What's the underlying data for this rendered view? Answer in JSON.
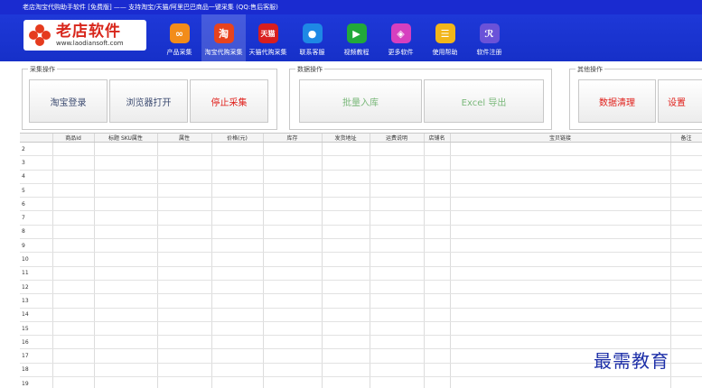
{
  "window": {
    "title": "老店淘宝代购助手软件 [免费版] —— 支持淘宝/天猫/阿里巴巴商品一键采集 (QQ:售后客服)"
  },
  "logo": {
    "name": "老店软件",
    "url": "www.laodiansoft.com"
  },
  "nav": {
    "items": [
      {
        "label": "产品采集",
        "icon": "link-icon",
        "color": "#f28c1a",
        "glyph": "∞",
        "active": false
      },
      {
        "label": "淘宝代购采集",
        "icon": "taobao-icon",
        "color": "#e8431d",
        "glyph": "淘",
        "active": true
      },
      {
        "label": "天猫代购采集",
        "icon": "tmall-icon",
        "color": "#d81e1e",
        "glyph": "天猫",
        "active": false
      },
      {
        "label": "联系客服",
        "icon": "qq-icon",
        "color": "#1e88e5",
        "glyph": "●",
        "active": false
      },
      {
        "label": "视频教程",
        "icon": "play-icon",
        "color": "#22a83a",
        "glyph": "▶",
        "active": false
      },
      {
        "label": "更多软件",
        "icon": "box-icon",
        "color": "#d63fbf",
        "glyph": "◈",
        "active": false
      },
      {
        "label": "使用帮助",
        "icon": "document-icon",
        "color": "#f2b51a",
        "glyph": "☰",
        "active": false
      },
      {
        "label": "软件注册",
        "icon": "users-icon",
        "color": "#6a52d8",
        "glyph": "ℛ",
        "active": false
      }
    ]
  },
  "groups": {
    "collect": {
      "title": "采集操作",
      "buttons": [
        "淘宝登录",
        "浏览器打开",
        "停止采集"
      ]
    },
    "data": {
      "title": "数据操作",
      "buttons": [
        "批量入库",
        "Excel 导出"
      ]
    },
    "other": {
      "title": "其他操作",
      "buttons": [
        "数据清理",
        "设置"
      ]
    }
  },
  "table": {
    "columns": [
      "商品Id",
      "标题 SKU属性",
      "属性",
      "价格(元)",
      "库存",
      "发货地址",
      "运费说明",
      "店铺名",
      "宝贝链接",
      "备注"
    ],
    "row_numbers": [
      "2",
      "3",
      "4",
      "5",
      "6",
      "7",
      "8",
      "9",
      "10",
      "11",
      "12",
      "13",
      "14",
      "15",
      "16",
      "17",
      "18",
      "19"
    ]
  },
  "watermark": {
    "text": "最需教育"
  }
}
